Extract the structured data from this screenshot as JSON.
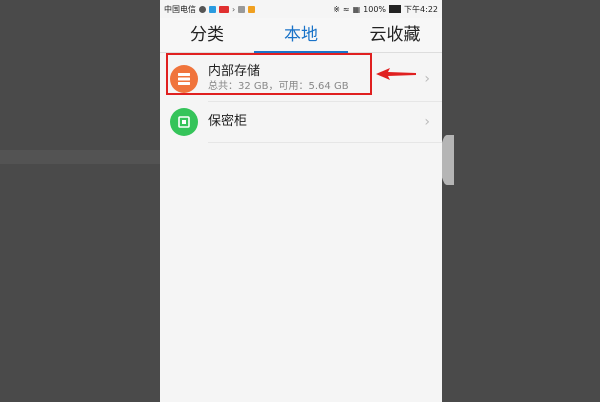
{
  "status_bar": {
    "carrier": "中国电信",
    "battery": "100%",
    "time": "下午4:22"
  },
  "tabs": [
    {
      "label": "分类",
      "active": false
    },
    {
      "label": "本地",
      "active": true
    },
    {
      "label": "云收藏",
      "active": false
    }
  ],
  "items": [
    {
      "title": "内部存储",
      "subtitle": "总共：32 GB，可用：5.64 GB",
      "icon": "storage-icon",
      "icon_color": "#f0743c"
    },
    {
      "title": "保密柜",
      "icon": "safe-icon",
      "icon_color": "#35c45a"
    }
  ],
  "colors": {
    "accent": "#1a73c8",
    "annotation": "#e02020"
  }
}
